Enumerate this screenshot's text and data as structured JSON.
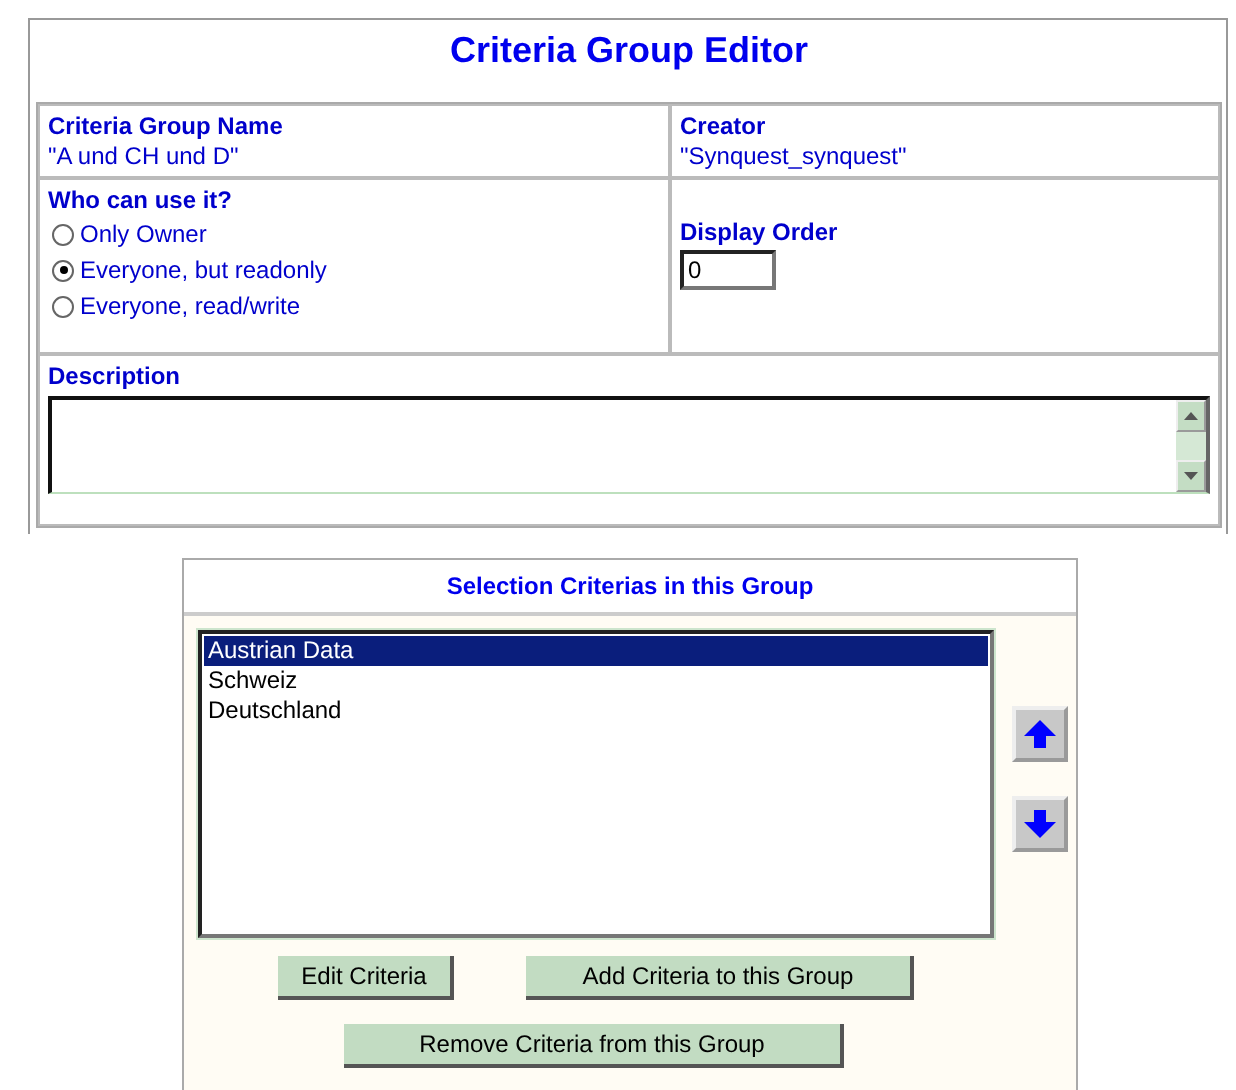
{
  "title": "Criteria Group Editor",
  "group_name": {
    "label": "Criteria Group Name",
    "value": "\"A und CH und D\""
  },
  "creator": {
    "label": "Creator",
    "value": "\"Synquest_synquest\""
  },
  "usage": {
    "label": "Who can use it?",
    "options": [
      {
        "label": "Only Owner",
        "selected": false
      },
      {
        "label": "Everyone, but readonly",
        "selected": true
      },
      {
        "label": "Everyone, read/write",
        "selected": false
      }
    ]
  },
  "display_order": {
    "label": "Display Order",
    "value": "0"
  },
  "description": {
    "label": "Description"
  },
  "criteria": {
    "title": "Selection Criterias in this Group",
    "items": [
      {
        "label": "Austrian Data",
        "selected": true
      },
      {
        "label": "Schweiz",
        "selected": false
      },
      {
        "label": "Deutschland",
        "selected": false
      }
    ]
  },
  "buttons": [
    "Edit Criteria",
    "Add Criteria to this Group",
    "Remove Criteria from this Group"
  ]
}
